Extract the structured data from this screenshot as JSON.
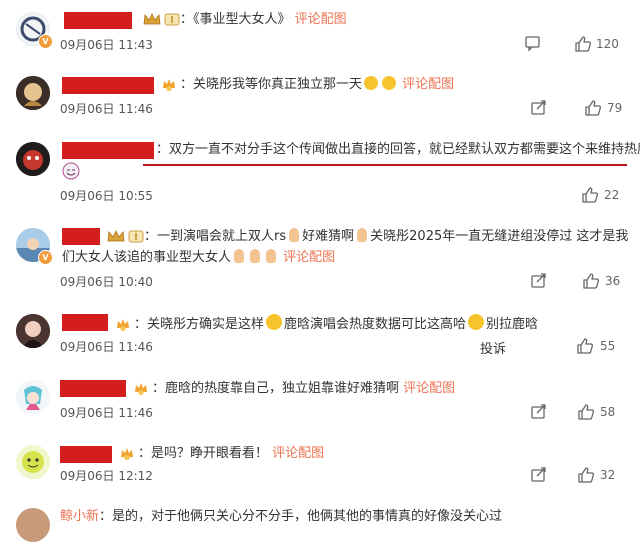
{
  "common": {
    "link_label": "评论配图",
    "colon": "："
  },
  "comments": [
    {
      "text": "《事业型大女人》",
      "date": "09月06日 11:43",
      "likes": "120"
    },
    {
      "text": "关晓彤我等你真正独立那一天",
      "date": "09月06日 11:46",
      "likes": "79"
    },
    {
      "text": "双方一直不对分手这个传闻做出直接的回答，就已经默认双方都需要这个来维持热度",
      "date": "09月06日 10:55",
      "likes": "22"
    },
    {
      "text1": "一到演唱会就上双人rs",
      "text2": "好难猜啊",
      "text3": "关晓彤2025年一直无缝进组没停过 这才是我",
      "text4": "们大女人该追的事业型大女人",
      "date": "09月06日 10:40",
      "likes": "36"
    },
    {
      "text1": "关晓彤方确实是这样",
      "text2": "鹿晗演唱会热度数据可比这高哈",
      "text3": "别拉鹿晗",
      "date": "09月06日 11:46",
      "likes": "55",
      "report": "投诉"
    },
    {
      "text": "鹿晗的热度靠自己，独立姐靠谁好难猜啊",
      "date": "09月06日 11:46",
      "likes": "58"
    },
    {
      "text": "是吗？睁开眼看看！",
      "date": "09月06日 12:12",
      "likes": "32"
    },
    {
      "name": "鲸小新",
      "text": "是的，对于他俩只关心分不分手，他俩其他的事情真的好像没关心过"
    }
  ]
}
